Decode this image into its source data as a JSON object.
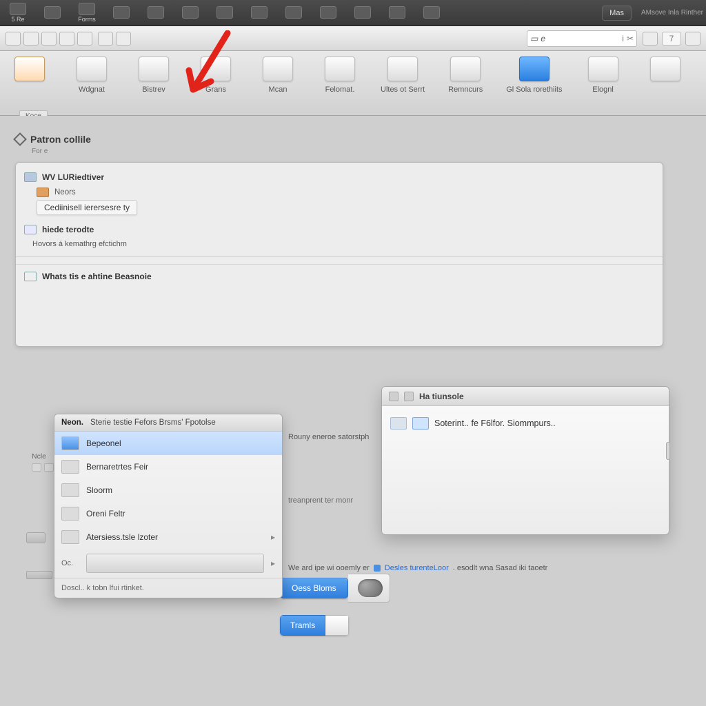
{
  "menubar": {
    "items": [
      {
        "label": "5 Re"
      },
      {
        "label": ""
      },
      {
        "label": "Forms"
      },
      {
        "label": ""
      },
      {
        "label": ""
      },
      {
        "label": ""
      },
      {
        "label": ""
      },
      {
        "label": ""
      },
      {
        "label": ""
      },
      {
        "label": ""
      },
      {
        "label": ""
      },
      {
        "label": ""
      },
      {
        "label": ""
      }
    ],
    "button": "Mas",
    "tail": "AMsove Inla Rinther"
  },
  "toolbar2": {
    "search_placeholder": "e",
    "page_number": "7"
  },
  "catbar": {
    "items": [
      {
        "label": ""
      },
      {
        "label": "Wdgnat"
      },
      {
        "label": "Bistrev"
      },
      {
        "label": "Grans"
      },
      {
        "label": "Mcan"
      },
      {
        "label": "Felomat."
      },
      {
        "label": "Ultes ot Serrt"
      },
      {
        "label": "Remncurs"
      },
      {
        "label": "Gl Sola rorethiits"
      },
      {
        "label": "Elognl"
      },
      {
        "label": ""
      }
    ],
    "badge": "Koce"
  },
  "section": {
    "title": "Patron collile",
    "subtitle": "For  e"
  },
  "panel": {
    "r1": "WV LURiedtiver",
    "r2": "Neors",
    "r3": "Cediinisell ierersesre ty",
    "h1": "hiede terodte",
    "n1": "Hovors á kemathrg efctichm",
    "h2": "Whats tis e ahtine Beasnoie",
    "hidden": "Ncle"
  },
  "ctx": {
    "head_a": "Neon.",
    "head_b": "Sterie testie Fefors Brsms' Fpotolse",
    "items": [
      "Bepeonel",
      "Bernaretrtes Feir",
      "Sloorm",
      "Oreni Feltr",
      "Atersiess.tsle lzoter"
    ],
    "oc": "Oc.",
    "foot": "Doscl.. k tobn lfui rtinket."
  },
  "side": {
    "a": "Rouny eneroe satorstph",
    "b": "treanprent ter monr",
    "c_pre": "We ard ipe wi ooemly er",
    "c_link": "Desles turenteLoor",
    "c_post": ". esodlt wna Sasad iki taoetr"
  },
  "detail": {
    "title": "Ha tiunsole",
    "body": "Soterint.. fe F6lfor. Siommpurs.."
  },
  "buttons": {
    "a": "Oess Bloms",
    "b": "Tramls"
  }
}
